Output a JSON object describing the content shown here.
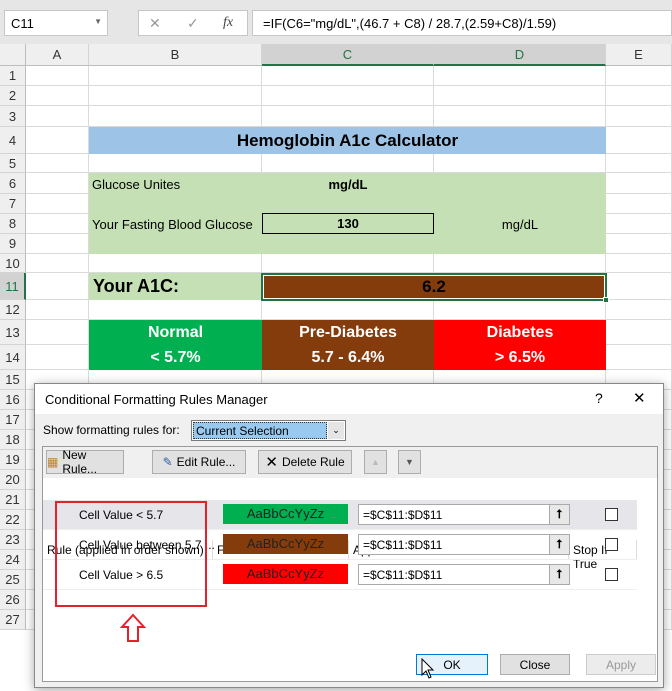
{
  "formula_bar": {
    "name_box": "C11",
    "cancel": "✕",
    "enter": "✓",
    "fx": "fx",
    "formula": "=IF(C6=\"mg/dL\",(46.7 + C8) / 28.7,(2.59+C8)/1.59)"
  },
  "columns": [
    "A",
    "B",
    "C",
    "D",
    "E"
  ],
  "rows": [
    "1",
    "2",
    "3",
    "4",
    "5",
    "6",
    "7",
    "8",
    "9",
    "10",
    "11",
    "12",
    "13",
    "14",
    "15",
    "16",
    "17",
    "18",
    "19",
    "20",
    "21",
    "22",
    "23",
    "24",
    "25",
    "26",
    "27"
  ],
  "sheet": {
    "title": "Hemoglobin A1c Calculator",
    "glucose_units_label": "Glucose Unites",
    "glucose_units_value": "mg/dL",
    "fasting_label": "Your Fasting Blood Glucose",
    "fasting_value": "130",
    "fasting_unit": "mg/dL",
    "a1c_label": "Your A1C:",
    "a1c_value": "6.2",
    "categories": [
      {
        "name": "Normal",
        "range": "< 5.7%",
        "color": "#00b050"
      },
      {
        "name": "Pre-Diabetes",
        "range": "5.7 - 6.4%",
        "color": "#843c0c"
      },
      {
        "name": "Diabetes",
        "range": "> 6.5%",
        "color": "#ff0000"
      }
    ],
    "colors": {
      "title_bg": "#9dc3e6",
      "input_bg": "#c5e0b4"
    }
  },
  "dialog": {
    "title": "Conditional Formatting Rules Manager",
    "help": "?",
    "close": "✕",
    "show_label": "Show formatting rules for:",
    "show_value": "Current Selection",
    "toolbar": {
      "new_rule": "New Rule...",
      "edit_rule": "Edit Rule...",
      "delete_rule": "Delete Rule"
    },
    "headers": [
      "Rule (applied in order shown)",
      "Format",
      "Applies to",
      "Stop If True"
    ],
    "rules": [
      {
        "rule": "Cell Value < 5.7",
        "preview": "AaBbCcYyZz",
        "color": "#00b050",
        "applies": "=$C$11:$D$11",
        "stop": false
      },
      {
        "rule": "Cell Value between 5.7 ...",
        "preview": "AaBbCcYyZz",
        "color": "#843c0c",
        "applies": "=$C$11:$D$11",
        "stop": false
      },
      {
        "rule": "Cell Value > 6.5",
        "preview": "AaBbCcYyZz",
        "color": "#ff0000",
        "applies": "=$C$11:$D$11",
        "stop": false
      }
    ],
    "buttons": {
      "ok": "OK",
      "close": "Close",
      "apply": "Apply"
    }
  }
}
